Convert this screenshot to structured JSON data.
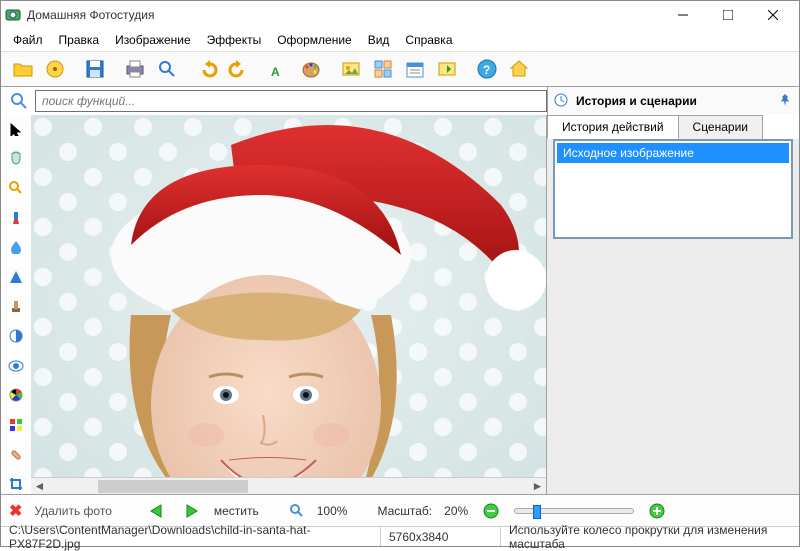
{
  "title": "Домашняя Фотостудия",
  "menu": [
    "Файл",
    "Правка",
    "Изображение",
    "Эффекты",
    "Оформление",
    "Вид",
    "Справка"
  ],
  "search": {
    "placeholder": "поиск функций..."
  },
  "side": {
    "header": "История и сценарии",
    "tabs": [
      "История действий",
      "Сценарии"
    ],
    "history_item": "Исходное изображение"
  },
  "footer": {
    "delete": "Удалить фото",
    "fit": "местить",
    "hundred": "100%",
    "scale_label": "Масштаб:",
    "scale_value": "20%"
  },
  "status": {
    "path": "C:\\Users\\ContentManager\\Downloads\\child-in-santa-hat-PX87F2D.jpg",
    "dims": "5760x3840",
    "hint": "Используйте колесо прокрутки для изменения масштаба"
  },
  "toolbar_icons": [
    "open",
    "catalog",
    "save",
    "print",
    "search",
    "undo",
    "redo",
    "text",
    "palette",
    "image",
    "collage",
    "calendar",
    "export",
    "help",
    "home"
  ],
  "tool_icons": [
    "pointer",
    "hand",
    "zoom",
    "brush",
    "blur",
    "shape",
    "stamp",
    "contrast",
    "eye",
    "color",
    "channels",
    "patch",
    "crop"
  ]
}
